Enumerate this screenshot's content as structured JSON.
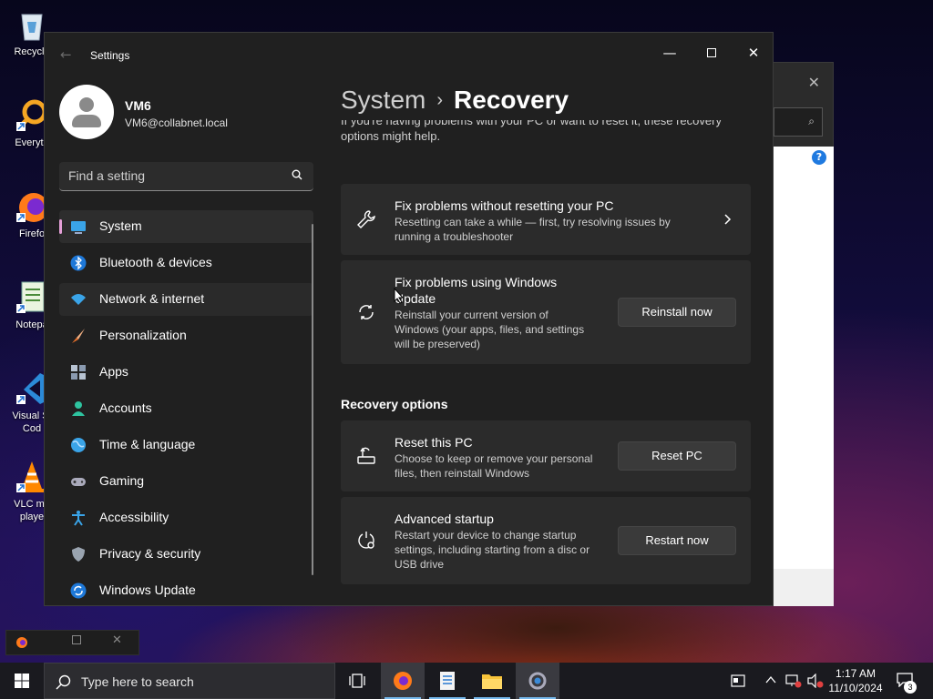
{
  "desktop": {
    "icons": [
      {
        "label": "Recycle",
        "icon": "recycle-bin-icon"
      },
      {
        "label": "Everyth",
        "icon": "everything-search-icon"
      },
      {
        "label": "Firefo",
        "icon": "firefox-icon"
      },
      {
        "label": "Notepa",
        "icon": "notepad-icon"
      },
      {
        "label": "Visual St\nCod",
        "icon": "vscode-icon"
      },
      {
        "label": "VLC me\nplaye",
        "icon": "vlc-icon"
      }
    ]
  },
  "window": {
    "title": "Settings",
    "controls": {
      "minimize": "—",
      "close": "✕"
    }
  },
  "user": {
    "name": "VM6",
    "email": "VM6@collabnet.local"
  },
  "search": {
    "placeholder": "Find a setting"
  },
  "nav": [
    {
      "label": "System",
      "icon": "system-icon",
      "selected": true
    },
    {
      "label": "Bluetooth & devices",
      "icon": "bluetooth-icon"
    },
    {
      "label": "Network & internet",
      "icon": "network-icon"
    },
    {
      "label": "Personalization",
      "icon": "brush-icon"
    },
    {
      "label": "Apps",
      "icon": "apps-icon"
    },
    {
      "label": "Accounts",
      "icon": "accounts-icon"
    },
    {
      "label": "Time & language",
      "icon": "globe-clock-icon"
    },
    {
      "label": "Gaming",
      "icon": "gamepad-icon"
    },
    {
      "label": "Accessibility",
      "icon": "accessibility-icon"
    },
    {
      "label": "Privacy & security",
      "icon": "shield-icon"
    },
    {
      "label": "Windows Update",
      "icon": "windows-update-icon"
    }
  ],
  "breadcrumb": {
    "parent": "System",
    "separator": "›",
    "current": "Recovery"
  },
  "content": {
    "intro": "If you're having problems with your PC or want to reset it, these recovery options might help.",
    "fix_troubleshoot": {
      "title": "Fix problems without resetting your PC",
      "desc": "Resetting can take a while — first, try resolving issues by running a troubleshooter"
    },
    "fix_update": {
      "title": "Fix problems using Windows Update",
      "desc": "Reinstall your current version of Windows (your apps, files, and settings will be preserved)",
      "button": "Reinstall now"
    },
    "section_title": "Recovery options",
    "reset": {
      "title": "Reset this PC",
      "desc": "Choose to keep or remove your personal files, then reinstall Windows",
      "button": "Reset PC"
    },
    "advanced": {
      "title": "Advanced startup",
      "desc": "Restart your device to change startup settings, including starting from a disc or USB drive",
      "button": "Restart now"
    }
  },
  "taskbar": {
    "search_text": "Type here to search",
    "time": "1:17 AM",
    "date": "11/10/2024",
    "notifications": "3"
  },
  "colors": {
    "accent": "#76b9ed",
    "selection_bar": "#e5a0d8",
    "window_bg": "#202020",
    "card_bg": "#2b2b2b"
  }
}
